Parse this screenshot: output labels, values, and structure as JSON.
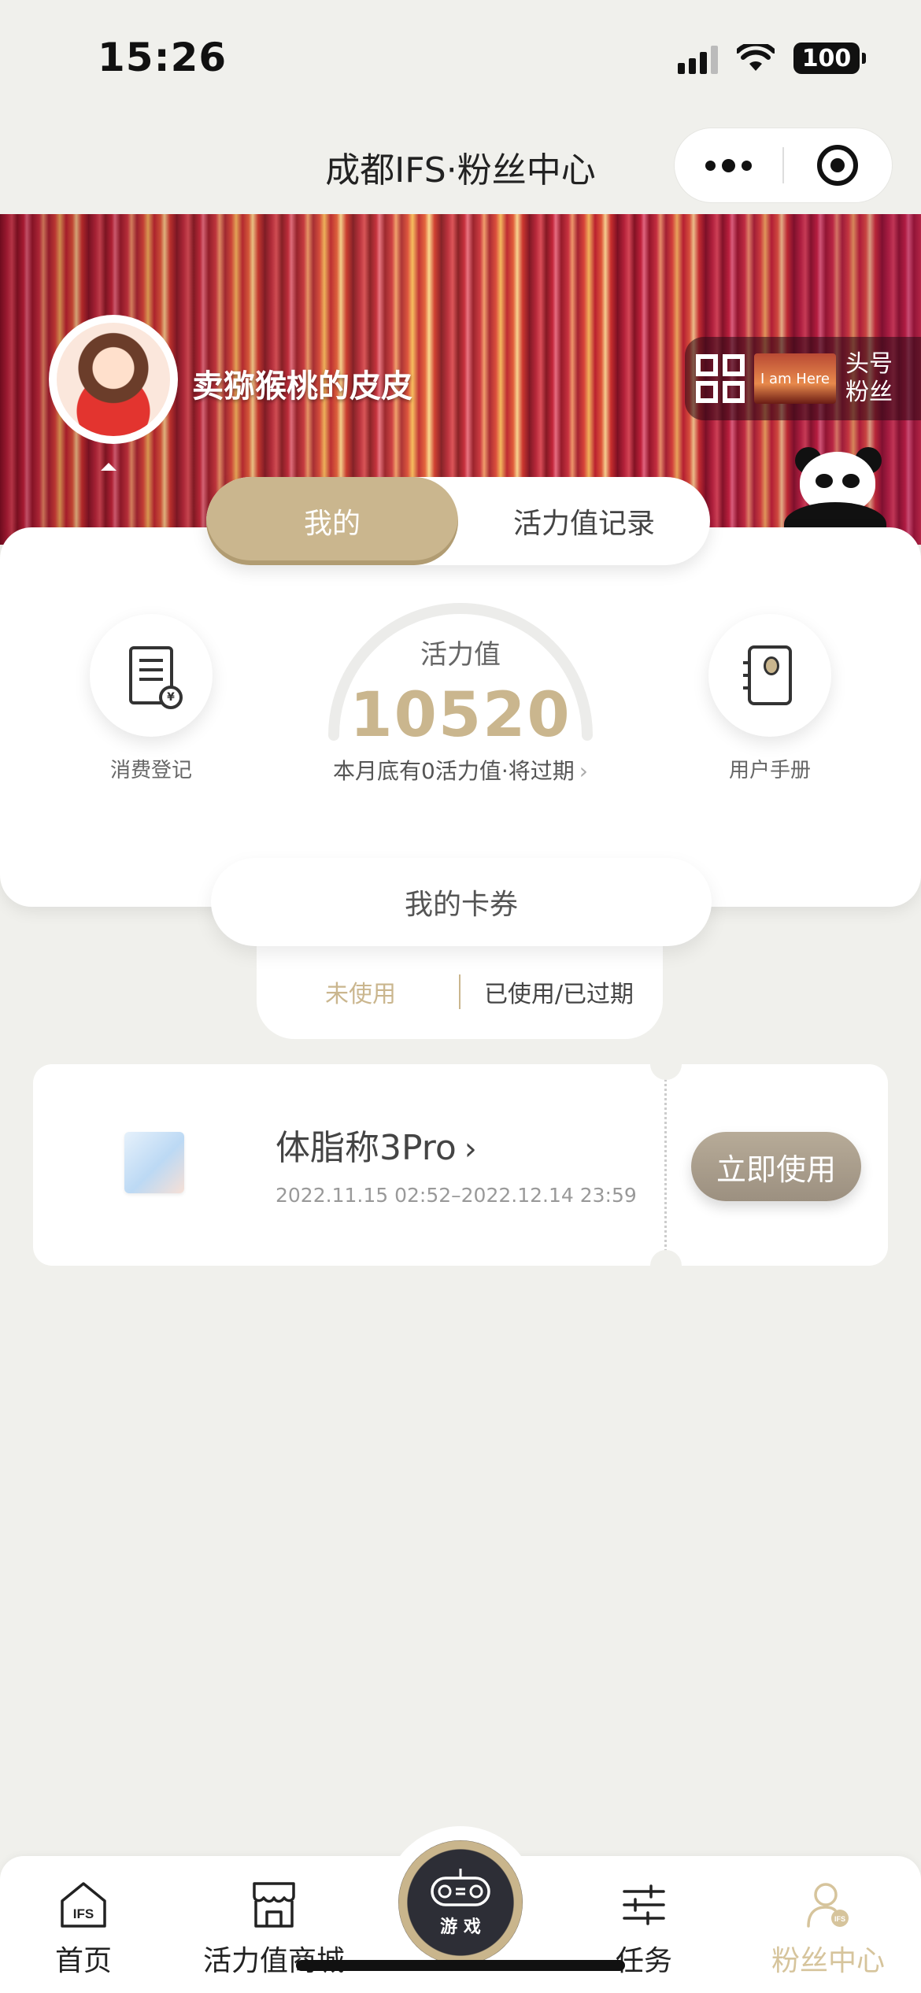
{
  "status_bar": {
    "time": "15:26",
    "battery": "100"
  },
  "navbar": {
    "title": "成都IFS·粉丝中心"
  },
  "profile": {
    "username": "卖猕猴桃的皮皮",
    "badge_image_text": "I am Here",
    "badge_text_line1": "头号",
    "badge_text_line2": "粉丝"
  },
  "tabs": [
    {
      "label": "我的",
      "active": true
    },
    {
      "label": "活力值记录",
      "active": false
    }
  ],
  "quick_actions": {
    "left_label": "消费登记",
    "right_label": "用户手册"
  },
  "vitality": {
    "label": "活力值",
    "value": "10520",
    "expire_note": "本月底有0活力值·将过期"
  },
  "coupons": {
    "header": "我的卡券",
    "filters": [
      {
        "label": "未使用",
        "active": true
      },
      {
        "label": "已使用/已过期",
        "active": false
      }
    ],
    "items": [
      {
        "title": "体脂称3Pro",
        "dates": "2022.11.15 02:52–2022.12.14 23:59",
        "action": "立即使用"
      }
    ]
  },
  "tabbar": {
    "items": [
      {
        "label": "首页",
        "icon": "home-ifs-icon"
      },
      {
        "label": "活力值商城",
        "icon": "store-icon"
      },
      {
        "label": "游 戏",
        "icon": "gamepad-icon"
      },
      {
        "label": "任务",
        "icon": "sliders-icon"
      },
      {
        "label": "粉丝中心",
        "icon": "user-icon",
        "active": true
      }
    ],
    "home_icon_text": "IFS",
    "fan_icon_text": "IFS"
  },
  "colors": {
    "accent": "#cab68e",
    "background": "#f0f0ec"
  }
}
